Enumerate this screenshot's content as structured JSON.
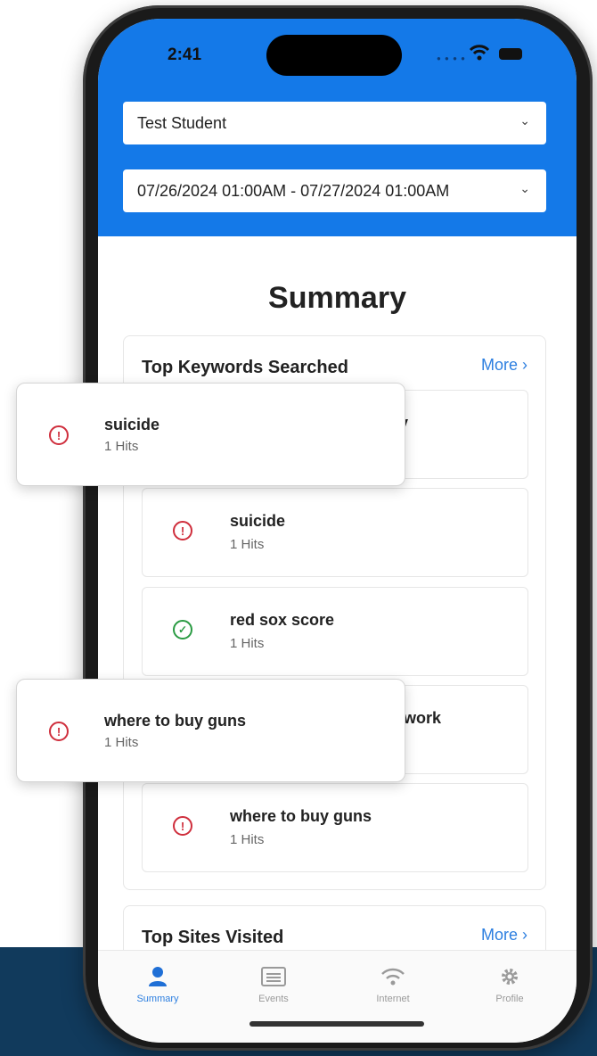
{
  "status_bar": {
    "time": "2:41"
  },
  "filters": {
    "student": "Test Student",
    "date_range": "07/26/2024 01:00AM - 07/27/2024 01:00AM"
  },
  "page_title": "Summary",
  "keywords_card": {
    "heading": "Top Keywords Searched",
    "more": "More",
    "hidden_item_1_fragment": "ly",
    "hidden_item_4_fragment": "ework",
    "items": [
      {
        "title": "suicide",
        "hits": "1 Hits",
        "status": "alert"
      },
      {
        "title": "red sox score",
        "hits": "1 Hits",
        "status": "ok"
      },
      {
        "title": "where to buy guns",
        "hits": "1 Hits",
        "status": "alert"
      }
    ]
  },
  "sites_card": {
    "heading": "Top Sites Visited",
    "more": "More"
  },
  "popups": [
    {
      "title": "suicide",
      "hits": "1 Hits"
    },
    {
      "title": "where to buy guns",
      "hits": "1 Hits"
    }
  ],
  "tabs": [
    {
      "label": "Summary",
      "icon": "person-icon",
      "active": true
    },
    {
      "label": "Events",
      "icon": "list-icon",
      "active": false
    },
    {
      "label": "Internet",
      "icon": "wifi-icon",
      "active": false
    },
    {
      "label": "Profile",
      "icon": "gear-icon",
      "active": false
    }
  ],
  "colors": {
    "header_blue": "#1479e8",
    "alert_red": "#cf2e3c",
    "ok_green": "#2a9b43",
    "link_blue": "#2d7fe0",
    "background_navy": "#113a5c"
  }
}
